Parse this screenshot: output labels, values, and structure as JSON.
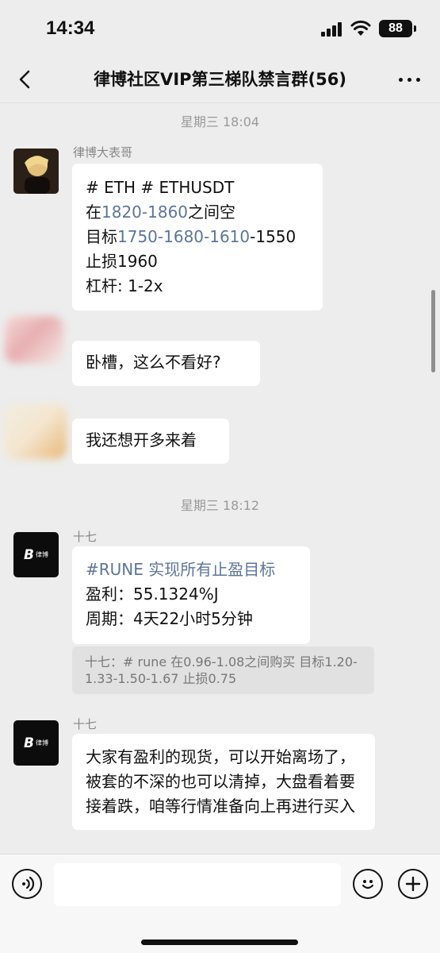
{
  "status_bar": {
    "time": "14:34",
    "battery": "88"
  },
  "chat": {
    "title": "律博社区VIP第三梯队禁言群(56)"
  },
  "timestamps": [
    "星期三 18:04",
    "星期三 18:12"
  ],
  "messages": [
    {
      "sender": "律博大表哥",
      "lines": {
        "l1": "# ETH # ETHUSDT",
        "l2_pre": "在",
        "l2_link": "1820-1860",
        "l2_post": "之间空",
        "l3_pre": "目标",
        "l3_link": "1750-1680-1610",
        "l3_post": "-1550",
        "l4": "止损1960",
        "l5": "杠杆: 1-2x"
      }
    },
    {
      "text": "卧槽，这么不看好?"
    },
    {
      "text": "我还想开多来着"
    },
    {
      "sender": "十七",
      "lines": {
        "l1": "#RUNE 实现所有止盈目标",
        "l2": "盈利：55.1324%J",
        "l3": "周期：4天22小时5分钟"
      },
      "quote": "十七：# rune 在0.96-1.08之间购买 目标1.20-1.33-1.50-1.67 止损0.75"
    },
    {
      "sender": "十七",
      "text": "大家有盈利的现货，可以开始离场了，被套的不深的也可以清掉，大盘看着要接着跌，咱等行情准备向上再进行买入"
    }
  ],
  "brand_avatar": {
    "mark": "B",
    "name": "律博"
  },
  "colors": {
    "background": "#ededed",
    "bubble": "#ffffff",
    "link": "#5d7598",
    "quote_bg": "#e1e1e1"
  },
  "icons": [
    "back-chevron-icon",
    "more-dots-icon",
    "voice-icon",
    "emoji-icon",
    "plus-icon"
  ]
}
